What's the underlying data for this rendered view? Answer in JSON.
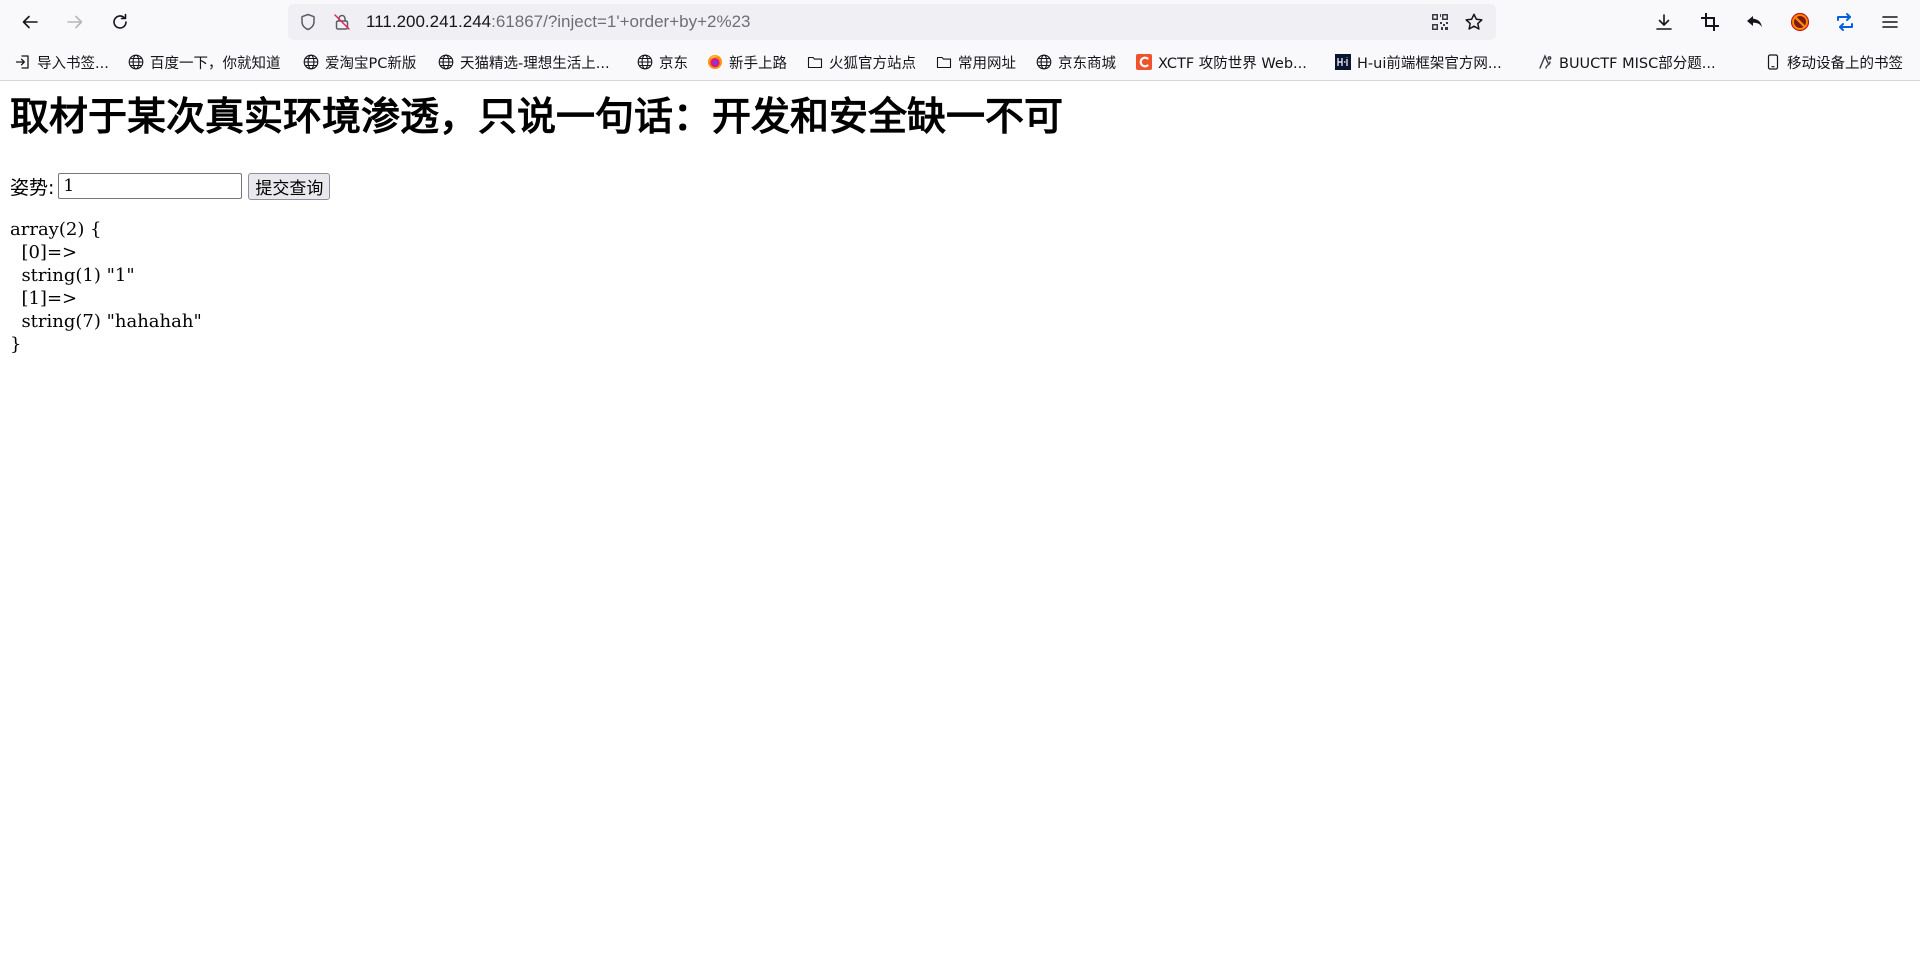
{
  "browser": {
    "url_host": "111.200.241.244",
    "url_rest": ":61867/?inject=1'+order+by+2%23",
    "bookmarks": [
      {
        "label": "导入书签...",
        "icon": "import-icon"
      },
      {
        "label": "百度一下，你就知道",
        "icon": "globe-icon"
      },
      {
        "label": "爱淘宝PC新版",
        "icon": "globe-icon"
      },
      {
        "label": "天猫精选-理想生活上...",
        "icon": "globe-icon"
      },
      {
        "label": "京东",
        "icon": "globe-icon"
      },
      {
        "label": "新手上路",
        "icon": "firefox-icon"
      },
      {
        "label": "火狐官方站点",
        "icon": "folder-icon"
      },
      {
        "label": "常用网址",
        "icon": "folder-icon"
      },
      {
        "label": "京东商城",
        "icon": "globe-icon"
      },
      {
        "label": "XCTF 攻防世界 Web...",
        "icon": "xctf-logo-icon"
      },
      {
        "label": "H-ui前端框架官方网...",
        "icon": "hui-logo-icon"
      },
      {
        "label": "BUUCTF MISC部分题...",
        "icon": "buuctf-logo-icon"
      },
      {
        "label": "移动设备上的书签",
        "icon": "mobile-icon"
      }
    ],
    "colors": {
      "chrome_bg": "#f9f9fb",
      "urlbar_bg": "#f0f0f4",
      "accent_blue": "#0060df",
      "xctf_red": "#f0522c"
    }
  },
  "page": {
    "heading": "取材于某次真实环境渗透，只说一句话：开发和安全缺一不可",
    "form": {
      "label": "姿势:",
      "input_value": "1",
      "submit_label": "提交查询"
    },
    "dump": "array(2) {\n  [0]=>\n  string(1) \"1\"\n  [1]=>\n  string(7) \"hahahah\"\n}"
  }
}
